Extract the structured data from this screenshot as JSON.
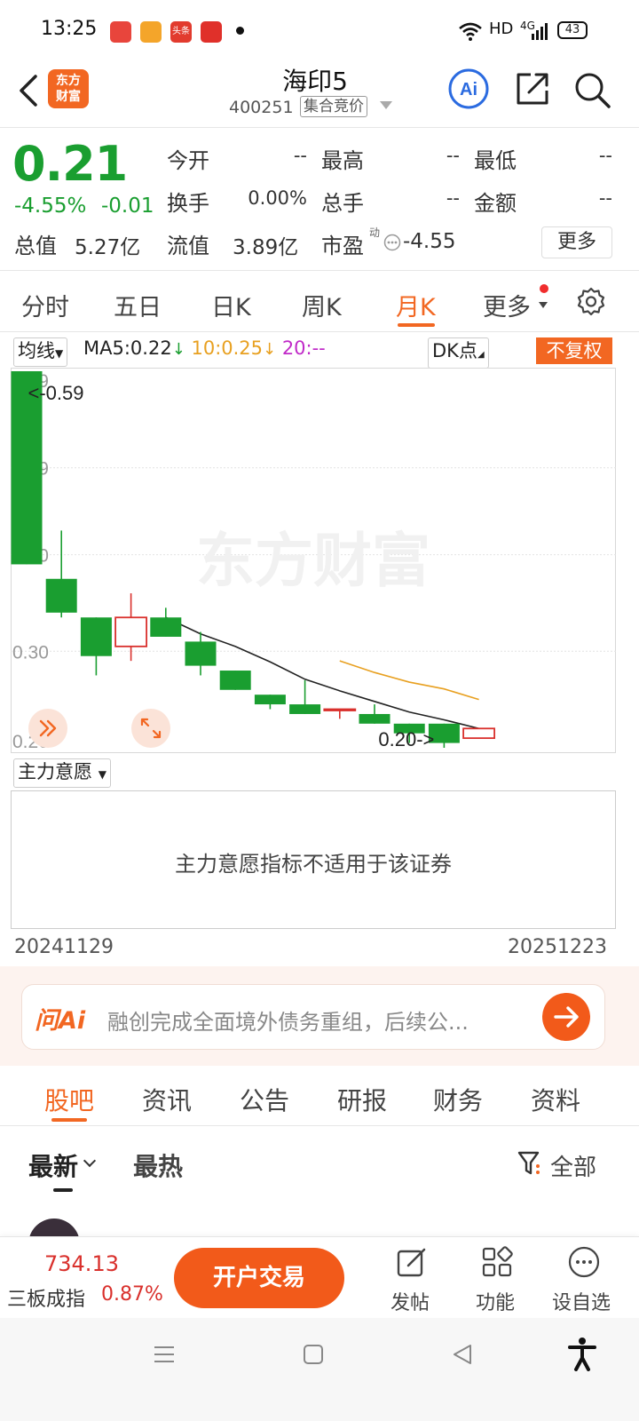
{
  "status_bar": {
    "time": "13:25",
    "network": "HD",
    "signal": "4G",
    "battery": "43",
    "app_icons": [
      "music-app-icon",
      "video-app-icon",
      "toutiao-app-icon",
      "video2-app-icon"
    ],
    "toutiao_label": "头条"
  },
  "header": {
    "logo_text_1": "东方",
    "logo_text_2": "财富",
    "stock_name": "海印5",
    "stock_code": "400251",
    "auction_tag": "集合竞价"
  },
  "quote": {
    "price": "0.21",
    "change_pct": "-4.55%",
    "change_abs": "-0.01",
    "open_label": "今开",
    "open_value": "--",
    "high_label": "最高",
    "high_value": "--",
    "low_label": "最低",
    "low_value": "--",
    "turnover_label": "换手",
    "turnover_value": "0.00%",
    "volume_label": "总手",
    "volume_value": "--",
    "amount_label": "金额",
    "amount_value": "--",
    "mktcap_label": "总值",
    "mktcap_value": "5.27亿",
    "float_label": "流值",
    "float_value": "3.89亿",
    "pe_label": "市盈",
    "pe_sup": "动",
    "pe_value": "-4.55",
    "more_button": "更多"
  },
  "chart_tabs": {
    "items": [
      "分时",
      "五日",
      "日K",
      "周K",
      "月K",
      "更多"
    ],
    "active": "月K"
  },
  "chart_toolbar": {
    "ma_select": "均线",
    "ma5": "MA5:0.22",
    "ma10": "10:0.25",
    "ma20": "20:--",
    "dk_select": "DK点",
    "adjust_button": "不复权"
  },
  "colors": {
    "accent": "#f26722",
    "down_green": "#1a9e30",
    "up_red": "#d9302c",
    "ma10": "#e8a020"
  },
  "chart_data": {
    "type": "candlestick",
    "period": "monthly",
    "ylim": [
      0.2,
      0.59
    ],
    "yticks": [
      "0.59",
      "0.49",
      "0.40",
      "0.30",
      "0.20"
    ],
    "max_annotation": "<-0.59",
    "min_annotation": "0.20->",
    "watermark": "东方财富",
    "x_start": "20241129",
    "x_end": "20251223",
    "candles": [
      {
        "open": 0.59,
        "high": 0.59,
        "low": 0.39,
        "close": 0.39
      },
      {
        "open": 0.375,
        "high": 0.425,
        "low": 0.335,
        "close": 0.34
      },
      {
        "open": 0.335,
        "high": 0.335,
        "low": 0.275,
        "close": 0.295
      },
      {
        "open": 0.305,
        "high": 0.36,
        "low": 0.29,
        "close": 0.335
      },
      {
        "open": 0.335,
        "high": 0.345,
        "low": 0.315,
        "close": 0.315
      },
      {
        "open": 0.31,
        "high": 0.32,
        "low": 0.275,
        "close": 0.285
      },
      {
        "open": 0.28,
        "high": 0.28,
        "low": 0.26,
        "close": 0.26
      },
      {
        "open": 0.255,
        "high": 0.255,
        "low": 0.24,
        "close": 0.245
      },
      {
        "open": 0.245,
        "high": 0.27,
        "low": 0.235,
        "close": 0.235
      },
      {
        "open": 0.24,
        "high": 0.24,
        "low": 0.23,
        "close": 0.24
      },
      {
        "open": 0.235,
        "high": 0.245,
        "low": 0.225,
        "close": 0.225
      },
      {
        "open": 0.225,
        "high": 0.225,
        "low": 0.205,
        "close": 0.215
      },
      {
        "open": 0.225,
        "high": 0.225,
        "low": 0.2,
        "close": 0.205
      },
      {
        "open": 0.21,
        "high": 0.22,
        "low": 0.21,
        "close": 0.22
      }
    ],
    "series": [
      {
        "name": "MA5",
        "values": [
          null,
          null,
          null,
          null,
          0.335,
          0.318,
          0.305,
          0.289,
          0.271,
          0.259,
          0.248,
          0.237,
          0.229,
          0.22
        ]
      },
      {
        "name": "MA10",
        "values": [
          null,
          null,
          null,
          null,
          null,
          null,
          null,
          null,
          null,
          0.29,
          0.278,
          0.268,
          0.261,
          0.25
        ]
      }
    ]
  },
  "indicator": {
    "select": "主力意愿",
    "message": "主力意愿指标不适用于该证券"
  },
  "ai_bar": {
    "logo": "问Ai",
    "text": "融创完成全面境外债务重组，后续公..."
  },
  "sub_tabs": {
    "items": [
      "股吧",
      "资讯",
      "公告",
      "研报",
      "财务",
      "资料"
    ],
    "active": "股吧"
  },
  "feed": {
    "sort_latest": "最新",
    "sort_hot": "最热",
    "filter": "全部"
  },
  "bottom_nav": {
    "index_value": "734.13",
    "index_name": "三板成指",
    "index_pct": "0.87%",
    "trade_button": "开户交易",
    "post": "发帖",
    "functions": "功能",
    "watchlist": "设自选"
  }
}
